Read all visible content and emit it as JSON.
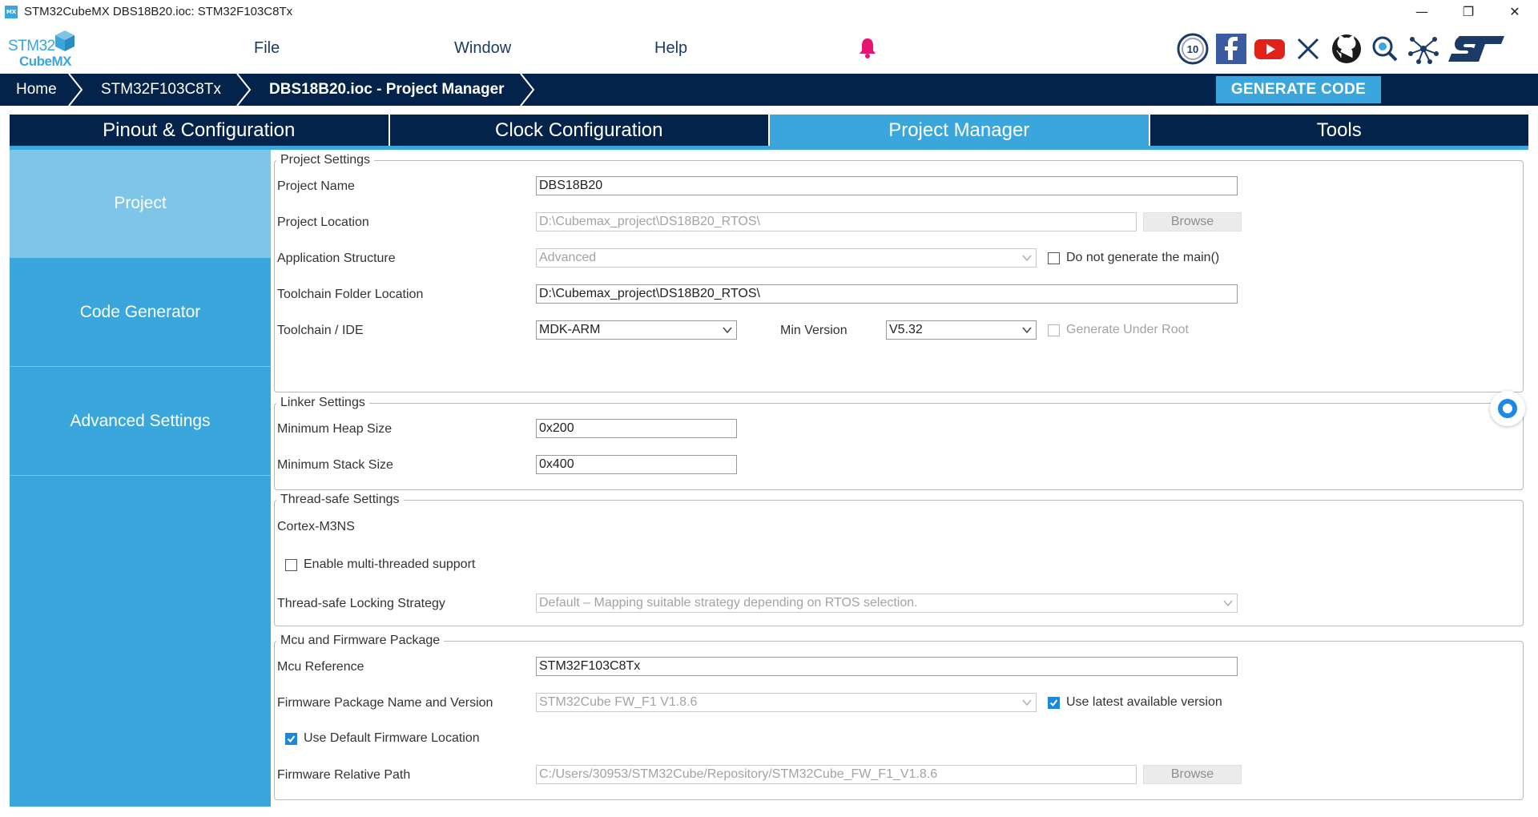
{
  "window": {
    "app_icon_text": "MX",
    "title": "STM32CubeMX DBS18B20.ioc: STM32F103C8Tx",
    "minimize": "—",
    "restore": "❐",
    "close": "✕"
  },
  "logo": {
    "line1a": "STM",
    "line1b": "32",
    "line2": "CubeMX"
  },
  "menu": [
    {
      "label": "File"
    },
    {
      "label": "Window"
    },
    {
      "label": "Help"
    }
  ],
  "icons": {
    "bell": "notification-bell-icon",
    "social": [
      "anniversary-10-icon",
      "facebook-icon",
      "youtube-icon",
      "x-icon",
      "github-icon",
      "community-icon",
      "network-icon",
      "st-logo-icon"
    ],
    "colors": {
      "accent": "#3aa6dc",
      "navy": "#03234b",
      "bell": "#e6156f",
      "facebook": "#3b5ba0",
      "youtube": "#e0231a"
    }
  },
  "breadcrumb": [
    {
      "label": "Home"
    },
    {
      "label": "STM32F103C8Tx"
    },
    {
      "label": "DBS18B20.ioc - Project Manager"
    }
  ],
  "generate_label": "GENERATE CODE",
  "tabs": [
    {
      "label": "Pinout & Configuration"
    },
    {
      "label": "Clock Configuration"
    },
    {
      "label": "Project Manager",
      "active": true
    },
    {
      "label": "Tools"
    }
  ],
  "sidebar": [
    {
      "label": "Project",
      "active": true
    },
    {
      "label": "Code Generator"
    },
    {
      "label": "Advanced Settings"
    }
  ],
  "project_settings": {
    "legend": "Project Settings",
    "project_name_label": "Project Name",
    "project_name_value": "DBS18B20",
    "project_location_label": "Project Location",
    "project_location_value": "D:\\Cubemax_project\\DS18B20_RTOS\\",
    "browse_label": "Browse",
    "app_structure_label": "Application Structure",
    "app_structure_value": "Advanced",
    "no_main_label": "Do not generate the main()",
    "toolchain_folder_label": "Toolchain Folder Location",
    "toolchain_folder_value": "D:\\Cubemax_project\\DS18B20_RTOS\\",
    "toolchain_ide_label": "Toolchain / IDE",
    "toolchain_ide_value": "MDK-ARM",
    "min_version_label": "Min Version",
    "min_version_value": "V5.32",
    "gen_under_root_label": "Generate Under Root"
  },
  "linker_settings": {
    "legend": "Linker Settings",
    "heap_label": "Minimum Heap Size",
    "heap_value": "0x200",
    "stack_label": "Minimum Stack Size",
    "stack_value": "0x400"
  },
  "thread_safe": {
    "legend": "Thread-safe Settings",
    "core_label": "Cortex-M3NS",
    "multi_thread_label": "Enable multi-threaded support",
    "locking_label": "Thread-safe Locking Strategy",
    "locking_value": "Default – Mapping suitable strategy depending on RTOS selection."
  },
  "mcu_firmware": {
    "legend": "Mcu and Firmware Package",
    "mcu_ref_label": "Mcu Reference",
    "mcu_ref_value": "STM32F103C8Tx",
    "fw_name_label": "Firmware Package Name and Version",
    "fw_name_value": "STM32Cube FW_F1 V1.8.6",
    "use_latest_label": "Use latest available version",
    "use_default_label": "Use Default Firmware Location",
    "fw_path_label": "Firmware Relative Path",
    "fw_path_value": "C:/Users/30953/STM32Cube/Repository/STM32Cube_FW_F1_V1.8.6",
    "browse_label": "Browse"
  }
}
